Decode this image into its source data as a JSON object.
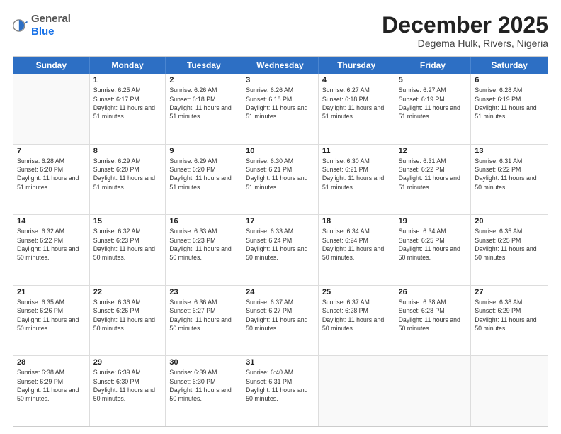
{
  "logo": {
    "general": "General",
    "blue": "Blue"
  },
  "header": {
    "month": "December 2025",
    "location": "Degema Hulk, Rivers, Nigeria"
  },
  "weekdays": [
    "Sunday",
    "Monday",
    "Tuesday",
    "Wednesday",
    "Thursday",
    "Friday",
    "Saturday"
  ],
  "weeks": [
    [
      {
        "day": "",
        "empty": true
      },
      {
        "day": "1",
        "sunrise": "6:25 AM",
        "sunset": "6:17 PM",
        "daylight": "11 hours and 51 minutes."
      },
      {
        "day": "2",
        "sunrise": "6:26 AM",
        "sunset": "6:18 PM",
        "daylight": "11 hours and 51 minutes."
      },
      {
        "day": "3",
        "sunrise": "6:26 AM",
        "sunset": "6:18 PM",
        "daylight": "11 hours and 51 minutes."
      },
      {
        "day": "4",
        "sunrise": "6:27 AM",
        "sunset": "6:18 PM",
        "daylight": "11 hours and 51 minutes."
      },
      {
        "day": "5",
        "sunrise": "6:27 AM",
        "sunset": "6:19 PM",
        "daylight": "11 hours and 51 minutes."
      },
      {
        "day": "6",
        "sunrise": "6:28 AM",
        "sunset": "6:19 PM",
        "daylight": "11 hours and 51 minutes."
      }
    ],
    [
      {
        "day": "7",
        "sunrise": "6:28 AM",
        "sunset": "6:20 PM",
        "daylight": "11 hours and 51 minutes."
      },
      {
        "day": "8",
        "sunrise": "6:29 AM",
        "sunset": "6:20 PM",
        "daylight": "11 hours and 51 minutes."
      },
      {
        "day": "9",
        "sunrise": "6:29 AM",
        "sunset": "6:20 PM",
        "daylight": "11 hours and 51 minutes."
      },
      {
        "day": "10",
        "sunrise": "6:30 AM",
        "sunset": "6:21 PM",
        "daylight": "11 hours and 51 minutes."
      },
      {
        "day": "11",
        "sunrise": "6:30 AM",
        "sunset": "6:21 PM",
        "daylight": "11 hours and 51 minutes."
      },
      {
        "day": "12",
        "sunrise": "6:31 AM",
        "sunset": "6:22 PM",
        "daylight": "11 hours and 51 minutes."
      },
      {
        "day": "13",
        "sunrise": "6:31 AM",
        "sunset": "6:22 PM",
        "daylight": "11 hours and 50 minutes."
      }
    ],
    [
      {
        "day": "14",
        "sunrise": "6:32 AM",
        "sunset": "6:22 PM",
        "daylight": "11 hours and 50 minutes."
      },
      {
        "day": "15",
        "sunrise": "6:32 AM",
        "sunset": "6:23 PM",
        "daylight": "11 hours and 50 minutes."
      },
      {
        "day": "16",
        "sunrise": "6:33 AM",
        "sunset": "6:23 PM",
        "daylight": "11 hours and 50 minutes."
      },
      {
        "day": "17",
        "sunrise": "6:33 AM",
        "sunset": "6:24 PM",
        "daylight": "11 hours and 50 minutes."
      },
      {
        "day": "18",
        "sunrise": "6:34 AM",
        "sunset": "6:24 PM",
        "daylight": "11 hours and 50 minutes."
      },
      {
        "day": "19",
        "sunrise": "6:34 AM",
        "sunset": "6:25 PM",
        "daylight": "11 hours and 50 minutes."
      },
      {
        "day": "20",
        "sunrise": "6:35 AM",
        "sunset": "6:25 PM",
        "daylight": "11 hours and 50 minutes."
      }
    ],
    [
      {
        "day": "21",
        "sunrise": "6:35 AM",
        "sunset": "6:26 PM",
        "daylight": "11 hours and 50 minutes."
      },
      {
        "day": "22",
        "sunrise": "6:36 AM",
        "sunset": "6:26 PM",
        "daylight": "11 hours and 50 minutes."
      },
      {
        "day": "23",
        "sunrise": "6:36 AM",
        "sunset": "6:27 PM",
        "daylight": "11 hours and 50 minutes."
      },
      {
        "day": "24",
        "sunrise": "6:37 AM",
        "sunset": "6:27 PM",
        "daylight": "11 hours and 50 minutes."
      },
      {
        "day": "25",
        "sunrise": "6:37 AM",
        "sunset": "6:28 PM",
        "daylight": "11 hours and 50 minutes."
      },
      {
        "day": "26",
        "sunrise": "6:38 AM",
        "sunset": "6:28 PM",
        "daylight": "11 hours and 50 minutes."
      },
      {
        "day": "27",
        "sunrise": "6:38 AM",
        "sunset": "6:29 PM",
        "daylight": "11 hours and 50 minutes."
      }
    ],
    [
      {
        "day": "28",
        "sunrise": "6:38 AM",
        "sunset": "6:29 PM",
        "daylight": "11 hours and 50 minutes."
      },
      {
        "day": "29",
        "sunrise": "6:39 AM",
        "sunset": "6:30 PM",
        "daylight": "11 hours and 50 minutes."
      },
      {
        "day": "30",
        "sunrise": "6:39 AM",
        "sunset": "6:30 PM",
        "daylight": "11 hours and 50 minutes."
      },
      {
        "day": "31",
        "sunrise": "6:40 AM",
        "sunset": "6:31 PM",
        "daylight": "11 hours and 50 minutes."
      },
      {
        "day": "",
        "empty": true
      },
      {
        "day": "",
        "empty": true
      },
      {
        "day": "",
        "empty": true
      }
    ]
  ]
}
